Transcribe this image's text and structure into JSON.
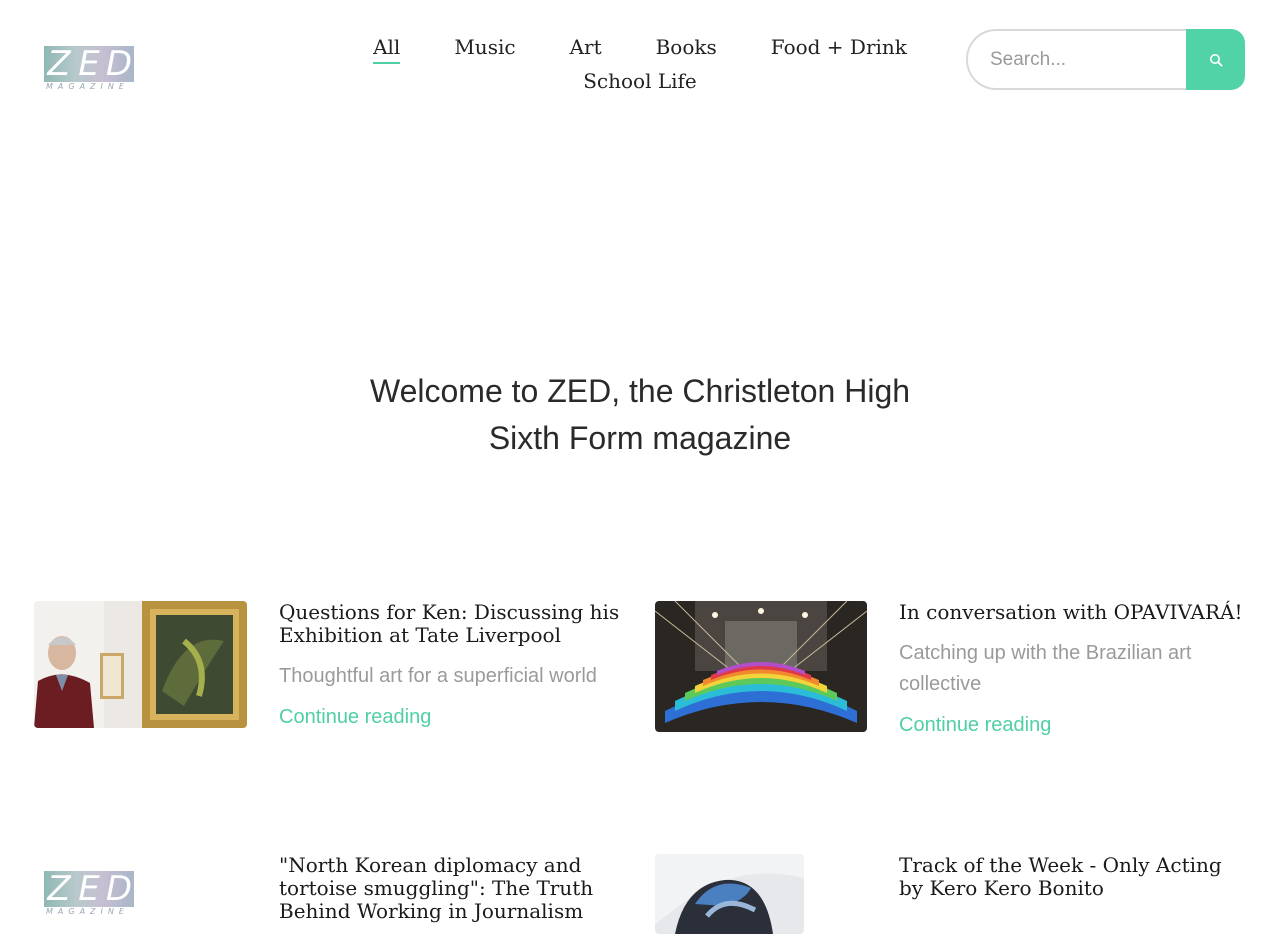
{
  "brand": {
    "letters": [
      "Z",
      "E",
      "D"
    ],
    "sub": "MAGAZINE"
  },
  "nav": {
    "items": [
      {
        "label": "All",
        "active": true
      },
      {
        "label": "Music"
      },
      {
        "label": "Art"
      },
      {
        "label": "Books"
      },
      {
        "label": "Food + Drink"
      },
      {
        "label": "School Life"
      }
    ]
  },
  "search": {
    "placeholder": "Search...",
    "button_icon": "search-icon"
  },
  "hero": {
    "line1": "Welcome to ZED, the Christleton High",
    "line2": "Sixth Form magazine"
  },
  "articles": [
    {
      "title": "Questions for Ken: Discussing his Exhibition at Tate Liverpool",
      "excerpt": "Thoughtful art for a superficial world",
      "link": "Continue reading"
    },
    {
      "title": "In conversation with OPAVIVARÁ!",
      "excerpt": "Catching up with the Brazilian art collective",
      "link": "Continue reading"
    },
    {
      "title": "\"North Korean diplomacy and tortoise smuggling\": The Truth Behind Working in Journalism"
    },
    {
      "title": "Track of the Week - Only Acting by  Kero Kero Bonito"
    }
  ],
  "colors": {
    "accent": "#52d3a7",
    "text": "#222222",
    "muted": "#9a9a9a"
  }
}
